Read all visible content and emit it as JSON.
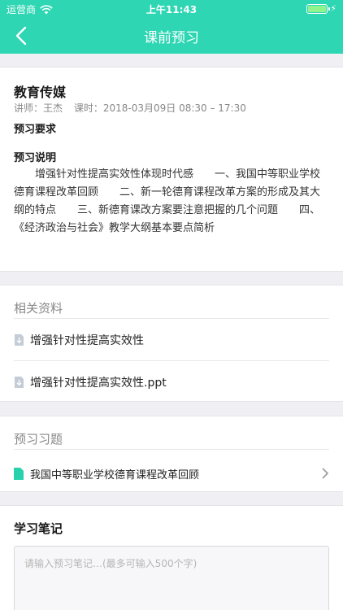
{
  "status_bar": {
    "carrier": "运营商",
    "time": "上午11:43"
  },
  "nav": {
    "title": "课前预习"
  },
  "course": {
    "title": "教育传媒",
    "lecturer": "讲师：王杰",
    "schedule": "课时：2018-03月09日 08:30 – 17:30",
    "requirement_label": "预习要求",
    "description_label": "预习说明",
    "description": "增强针对性提高实效性体现时代感　　一、我国中等职业学校德育课程改革回顾　　二、新一轮德育课程改革方案的形成及其大纲的特点　　三、新德育课改方案要注意把握的几个问题　　四、《经济政治与社会》教学大纲基本要点简析"
  },
  "materials": {
    "heading": "相关资料",
    "files": [
      {
        "name": "增强针对性提高实效性"
      },
      {
        "name": "增强针对性提高实效性.ppt"
      }
    ]
  },
  "exercises": {
    "heading": "预习习题",
    "items": [
      {
        "name": "我国中等职业学校德育课程改革回顾"
      }
    ]
  },
  "notes": {
    "heading": "学习笔记",
    "placeholder": "请输入预习笔记…(最多可输入500个字)"
  },
  "colors": {
    "accent": "#2ed6b3",
    "doc_icon": "#26d1ac",
    "file_icon": "#c4ccd6"
  }
}
